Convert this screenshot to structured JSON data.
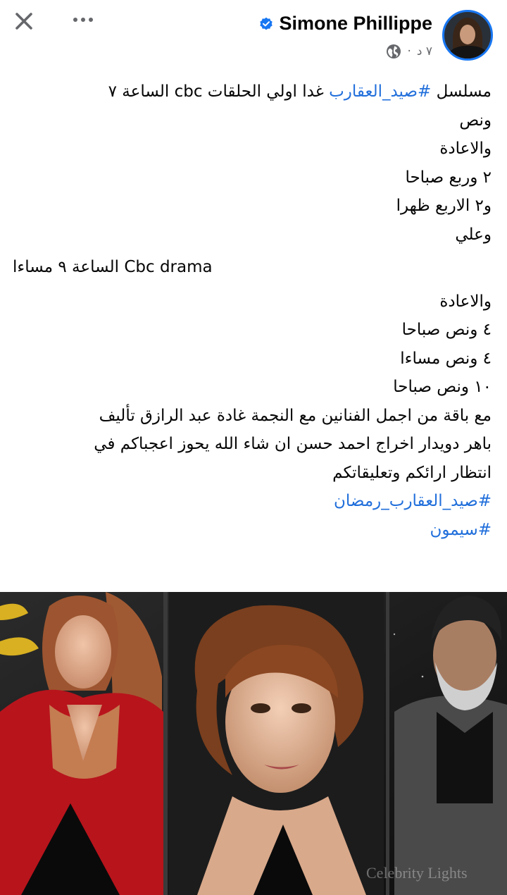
{
  "header": {
    "close_icon": "close-icon",
    "more_icon": "more-horizontal-icon",
    "author_name": "Simone Phillippe",
    "verified_icon": "verified-badge-icon",
    "timestamp": "٧ د",
    "separator": "·",
    "privacy_icon": "globe-icon"
  },
  "post": {
    "lines": {
      "l1_a": "مسلسل ",
      "l1_hashtag": "#صيد_العقارب",
      "l1_b": " غدا اولي الحلقات cbc الساعة ٧",
      "l2": "ونص",
      "l3": "والاعادة",
      "l4": "٢ وربع صباحا",
      "l5": "و٢ الاربع ظهرا",
      "l6": "وعلي",
      "l7": "الساعة ٩ مساءا Cbc drama",
      "l8": "والاعادة",
      "l9": "٤ ونص صباحا",
      "l10": "٤ ونص مساءا",
      "l11": "١٠ ونص صباحا",
      "l12": "مع باقة من اجمل الفنانين مع النجمة غادة عبد الرازق تأليف",
      "l13": "باهر دويدار اخراج احمد حسن ان شاء الله يحوز اعجباكم في",
      "l14": "انتظار ارائكم وتعليقاتكم",
      "l15_hashtag": "#صيد_العقارب_رمضان",
      "l16_hashtag": "#سيمون"
    }
  },
  "image": {
    "watermark": "Celebrity Lights"
  },
  "colors": {
    "hashtag": "#216fdb",
    "verified": "#1877f2",
    "meta_text": "#65676b",
    "text": "#050505"
  }
}
